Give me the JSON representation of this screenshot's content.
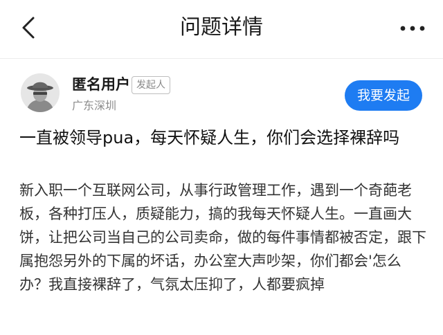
{
  "header": {
    "title": "问题详情",
    "back_icon": "chevron-left-icon",
    "more_icon": "more-dots-icon"
  },
  "author": {
    "name": "匿名用户",
    "badge": "发起人",
    "location": "广东深圳",
    "avatar_icon": "anonymous-avatar-icon"
  },
  "actions": {
    "ask_label": "我要发起",
    "ask_color": "#1e7cf2"
  },
  "question": {
    "title": "一直被领导pua，每天怀疑人生，你们会选择裸辞吗",
    "body": "新入职一个互联网公司，从事行政管理工作，遇到一个奇葩老板，各种打压人，质疑能力，搞的我每天怀疑人生。一直画大饼，让把公司当自己的公司卖命，做的每件事情都被否定，跟下属抱怨另外的下属的坏话，办公室大声吵架，你们都会'怎么办？我直接裸辞了，气氛太压抑了，人都要疯掉"
  }
}
